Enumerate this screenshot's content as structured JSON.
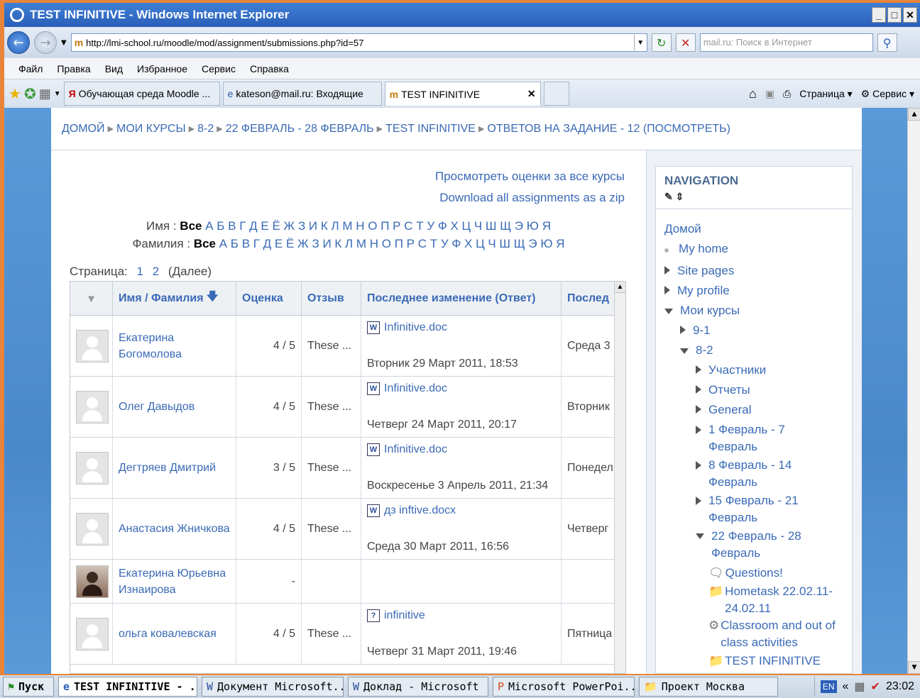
{
  "window": {
    "title": "TEST INFINITIVE - Windows Internet Explorer",
    "controls": [
      "_",
      "□",
      "✕"
    ]
  },
  "address": {
    "url": "http://lmi-school.ru/moodle/mod/assignment/submissions.php?id=57",
    "search_placeholder": "mail.ru: Поиск в Интернет"
  },
  "menu": [
    "Файл",
    "Правка",
    "Вид",
    "Избранное",
    "Сервис",
    "Справка"
  ],
  "tabs": [
    {
      "label": "Обучающая среда Moodle ..."
    },
    {
      "label": "kateson@mail.ru: Входящие"
    },
    {
      "label": "TEST INFINITIVE"
    }
  ],
  "toolbar": {
    "page_label": "Страница",
    "tools_label": "Сервис"
  },
  "breadcrumb": [
    "ДОМОЙ",
    "МОИ КУРСЫ",
    "8-2",
    "22 ФЕВРАЛЬ - 28 ФЕВРАЛЬ",
    "TEST INFINITIVE",
    "ОТВЕТОВ НА ЗАДАНИЕ - 12 (ПОСМОТРЕТЬ)"
  ],
  "links": {
    "view_grades": "Просмотреть оценки за все курсы",
    "download_zip": "Download all assignments as a zip"
  },
  "filter": {
    "first_label": "Имя :",
    "last_label": "Фамилия :",
    "all": "Все",
    "letters": "А Б В Г Д Е Ё Ж З И К Л М Н О П Р С Т У Ф Х Ц Ч Ш Щ Э Ю Я"
  },
  "pager": {
    "label": "Страница:",
    "pages": [
      "1",
      "2"
    ],
    "next": "(Далее)"
  },
  "table": {
    "headers": [
      "Имя / Фамилия",
      "Оценка",
      "Отзыв",
      "Последнее изменение (Ответ)",
      "Послед"
    ],
    "rows": [
      {
        "name": "Екатерина Богомолова",
        "grade": "4 / 5",
        "feedback": "These ...",
        "file": "Infinitive.doc",
        "submitted": "Вторник 29 Март 2011, 18:53",
        "last": "Среда 3"
      },
      {
        "name": "Олег Давыдов",
        "grade": "4 / 5",
        "feedback": "These ...",
        "file": "Infinitive.doc",
        "submitted": "Четверг 24 Март 2011, 20:17",
        "last": "Вторник"
      },
      {
        "name": "Дегтряев Дмитрий",
        "grade": "3 / 5",
        "feedback": "These ...",
        "file": "Infinitive.doc",
        "submitted": "Воскресенье 3 Апрель 2011, 21:34",
        "last": "Понедел"
      },
      {
        "name": "Анастасия Жничкова",
        "grade": "4 / 5",
        "feedback": "These ...",
        "file": "дз inftive.docx",
        "submitted": "Среда 30 Март 2011, 16:56",
        "last": "Четверг"
      },
      {
        "name": "Екатерина Юрьевна Изнаирова",
        "grade": "-",
        "feedback": "",
        "file": "",
        "submitted": "",
        "last": ""
      },
      {
        "name": "ольга ковалевская",
        "grade": "4 / 5",
        "feedback": "These ...",
        "file": "infinitive",
        "submitted": "Четверг 31 Март 2011, 19:46",
        "last": "Пятница"
      }
    ]
  },
  "navigation": {
    "title": "NAVIGATION",
    "items": [
      "Домой",
      "My home",
      "Site pages",
      "My profile",
      "Мои курсы",
      "9-1",
      "8-2",
      "Участники",
      "Отчеты",
      "General",
      "1 Февраль - 7 Февраль",
      "8 Февраль - 14 Февраль",
      "15 Февраль - 21 Февраль",
      "22 Февраль - 28 Февраль",
      "Questions!",
      "Hometask 22.02.11-24.02.11",
      "Classroom and out of class activities",
      "TEST INFINITIVE"
    ]
  },
  "taskbar": {
    "start": "Пуск",
    "items": [
      "TEST INFINITIVE - ...",
      "Документ Microsoft...",
      "Доклад - Microsoft ...",
      "Microsoft PowerPoi...",
      "Проект Москва"
    ],
    "lang": "EN",
    "time": "23:02"
  }
}
